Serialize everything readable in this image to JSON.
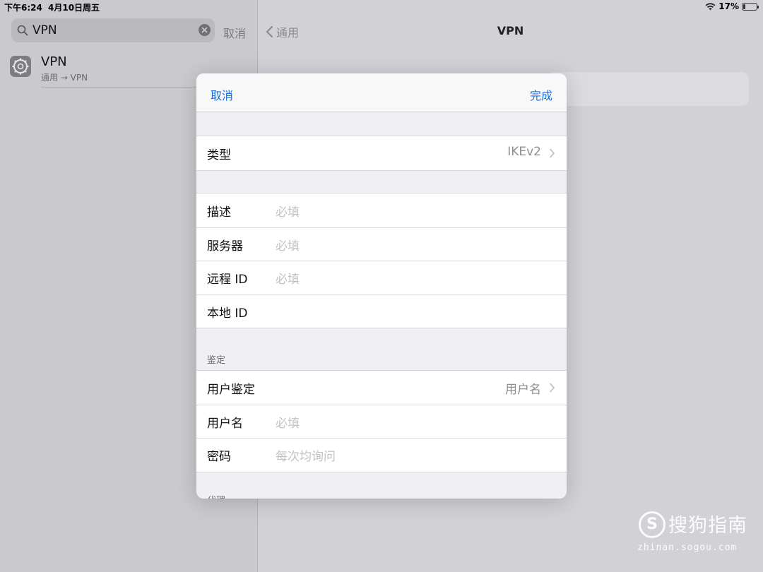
{
  "status_bar": {
    "time": "下午6:24",
    "date": "4月10日周五",
    "battery": "17%",
    "battery_level": 0.17
  },
  "sidebar": {
    "search": {
      "value": "VPN",
      "cancel_label": "取消"
    },
    "results": [
      {
        "title": "VPN",
        "subtitle": "通用 → VPN",
        "icon": "settings-gear-icon"
      }
    ]
  },
  "detail": {
    "back_label": "通用",
    "title": "VPN"
  },
  "modal": {
    "cancel_label": "取消",
    "done_label": "完成",
    "type_row": {
      "label": "类型",
      "value": "IKEv2"
    },
    "server_rows": [
      {
        "label": "描述",
        "placeholder": "必填"
      },
      {
        "label": "服务器",
        "placeholder": "必填"
      },
      {
        "label": "远程 ID",
        "placeholder": "必填"
      },
      {
        "label": "本地 ID",
        "placeholder": ""
      }
    ],
    "auth_header": "鉴定",
    "auth_rows": [
      {
        "label": "用户鉴定",
        "value": "用户名"
      },
      {
        "label": "用户名",
        "placeholder": "必填"
      },
      {
        "label": "密码",
        "placeholder": "每次均询问"
      }
    ],
    "proxy_header": "代理"
  },
  "watermark": {
    "brand": "搜狗指南",
    "url": "zhinan.sogou.com"
  },
  "colors": {
    "accent": "#1a6fe0",
    "placeholder": "#c2c2c6",
    "secondary_text": "#8e8e93"
  }
}
